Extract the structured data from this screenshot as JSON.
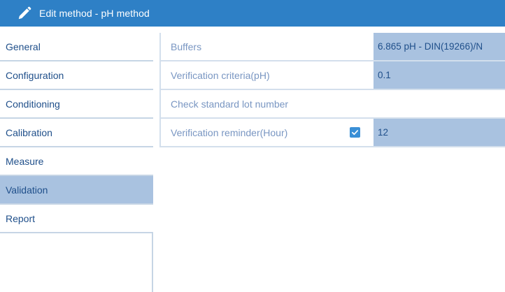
{
  "window": {
    "title": "Edit method - pH method"
  },
  "sidebar": {
    "items": [
      {
        "label": "General",
        "active": false
      },
      {
        "label": "Configuration",
        "active": false
      },
      {
        "label": "Conditioning",
        "active": false
      },
      {
        "label": "Calibration",
        "active": false
      },
      {
        "label": "Measure",
        "active": false
      },
      {
        "label": "Validation",
        "active": true
      },
      {
        "label": "Report",
        "active": false
      }
    ]
  },
  "validation": {
    "buffers": {
      "label": "Buffers",
      "value": "6.865 pH - DIN(19266)/N"
    },
    "criteria": {
      "label": "Verification criteria(pH)",
      "value": "0.1"
    },
    "lot": {
      "label": "Check standard lot number"
    },
    "reminder": {
      "label": "Verification reminder(Hour)",
      "checked": true,
      "value": "12"
    }
  },
  "colors": {
    "titlebar": "#2e80c6",
    "active_item": "#a9c2e0",
    "value_cell": "#a9c2e0",
    "checkbox": "#3a8fd6"
  },
  "icons": {
    "title": "pencil-icon",
    "checkbox": "check-icon"
  }
}
